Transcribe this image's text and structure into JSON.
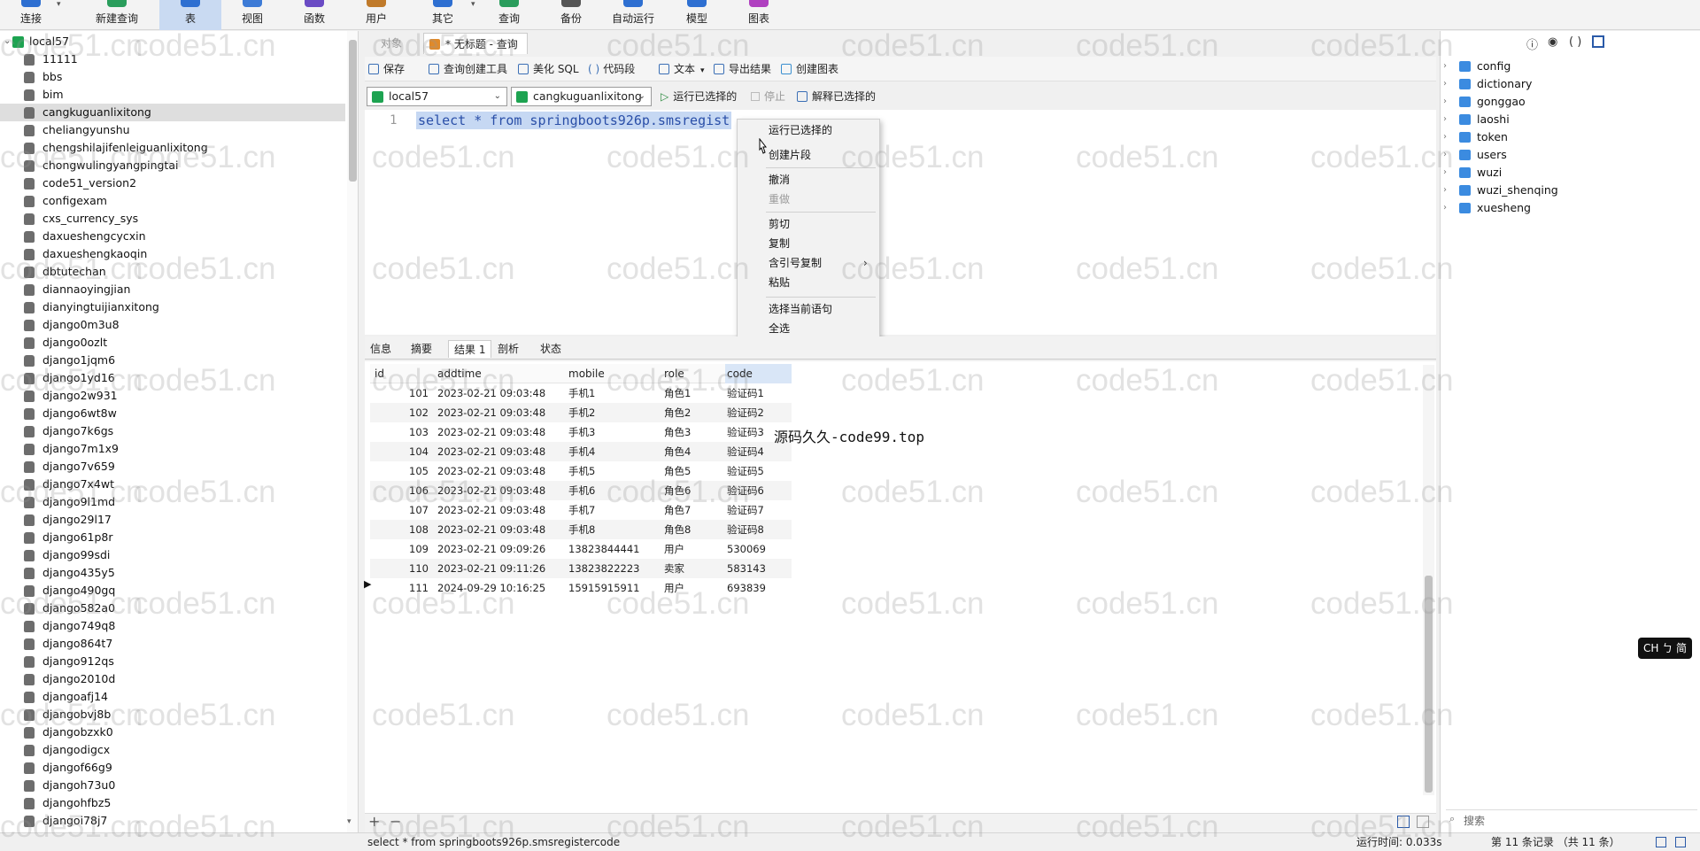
{
  "toolbar": {
    "buttons": [
      {
        "label": "连接",
        "color": "#2e6fd1"
      },
      {
        "label": "新建查询",
        "color": "#2a9d5c"
      },
      {
        "label": "表",
        "color": "#2e6fd1"
      },
      {
        "label": "视图",
        "color": "#3d7bd6"
      },
      {
        "label": "函数",
        "color": "#6a4bc4"
      },
      {
        "label": "用户",
        "color": "#c07a2a"
      },
      {
        "label": "其它",
        "color": "#2e6fd1"
      },
      {
        "label": "查询",
        "color": "#2a9d5c"
      },
      {
        "label": "备份",
        "color": "#555555"
      },
      {
        "label": "自动运行",
        "color": "#2e6fd1"
      },
      {
        "label": "模型",
        "color": "#2e6fd1"
      },
      {
        "label": "图表",
        "color": "#b040c0"
      }
    ]
  },
  "sidebar": {
    "connection": "local57",
    "items": [
      "11111",
      "bbs",
      "bim",
      "cangkuguanlixitong",
      "cheliangyunshu",
      "chengshilajifenleiguanlixitong",
      "chongwulingyangpingtai",
      "code51_version2",
      "configexam",
      "cxs_currency_sys",
      "daxueshengcycxin",
      "daxueshengkaoqin",
      "dbtutechan",
      "diannaoyingjian",
      "dianyingtuijianxitong",
      "django0m3u8",
      "django0ozlt",
      "django1jqm6",
      "django1yd16",
      "django2w931",
      "django6wt8w",
      "django7k6gs",
      "django7m1x9",
      "django7v659",
      "django7x4wt",
      "django9l1md",
      "django29l17",
      "django61p8r",
      "django99sdi",
      "django435y5",
      "django490gq",
      "django582a0",
      "django749q8",
      "django864t7",
      "django912qs",
      "django2010d",
      "djangoafj14",
      "djangobvj8b",
      "djangobzxk0",
      "djangodigcx",
      "djangof66g9",
      "djangoh73u0",
      "djangohfbz5",
      "djangoi78j7"
    ],
    "selected": "cangkuguanlixitong"
  },
  "tabs": {
    "objects": "对象",
    "query": "* 无标题 - 查询"
  },
  "editor_toolbar": {
    "save": "保存",
    "query_builder": "查询创建工具",
    "beautify": "美化 SQL",
    "snippet": "代码段",
    "text": "文本",
    "export": "导出结果",
    "create_chart": "创建图表"
  },
  "run_bar": {
    "connection": "local57",
    "database": "cangkuguanlixitong",
    "run_selected": "运行已选择的",
    "stop": "停止",
    "explain": "解释已选择的"
  },
  "editor": {
    "line_number": "1",
    "sql": "select  * from springboots926p.smsregist"
  },
  "context_menu": {
    "items": [
      {
        "label": "运行已选择的",
        "disabled": false
      },
      {
        "label": "创建片段",
        "disabled": false
      },
      {
        "label": "撤消",
        "disabled": false
      },
      {
        "label": "重做",
        "disabled": true
      },
      {
        "label": "剪切",
        "disabled": false
      },
      {
        "label": "复制",
        "disabled": false
      },
      {
        "label": "含引号复制",
        "disabled": false
      },
      {
        "label": "粘贴",
        "disabled": false
      },
      {
        "label": "选择当前语句",
        "disabled": false
      },
      {
        "label": "全选",
        "disabled": false
      }
    ],
    "submenu_arrow": "›"
  },
  "result_tabs": [
    "信息",
    "摘要",
    "结果 1",
    "剖析",
    "状态"
  ],
  "grid": {
    "columns": [
      "id",
      "addtime",
      "mobile",
      "role",
      "code"
    ],
    "rows": [
      [
        "101",
        "2023-02-21 09:03:48",
        "手机1",
        "角色1",
        "验证码1"
      ],
      [
        "102",
        "2023-02-21 09:03:48",
        "手机2",
        "角色2",
        "验证码2"
      ],
      [
        "103",
        "2023-02-21 09:03:48",
        "手机3",
        "角色3",
        "验证码3"
      ],
      [
        "104",
        "2023-02-21 09:03:48",
        "手机4",
        "角色4",
        "验证码4"
      ],
      [
        "105",
        "2023-02-21 09:03:48",
        "手机5",
        "角色5",
        "验证码5"
      ],
      [
        "106",
        "2023-02-21 09:03:48",
        "手机6",
        "角色6",
        "验证码6"
      ],
      [
        "107",
        "2023-02-21 09:03:48",
        "手机7",
        "角色7",
        "验证码7"
      ],
      [
        "108",
        "2023-02-21 09:03:48",
        "手机8",
        "角色8",
        "验证码8"
      ],
      [
        "109",
        "2023-02-21 09:09:26",
        "13823844441",
        "用户",
        "530069"
      ],
      [
        "110",
        "2023-02-21 09:11:26",
        "13823822223",
        "卖家",
        "583143"
      ],
      [
        "111",
        "2024-09-29 10:16:25",
        "15915915911",
        "用户",
        "693839"
      ]
    ]
  },
  "overlay_text": "源码久久-code99.top",
  "right_panel": {
    "tables": [
      "config",
      "dictionary",
      "gonggao",
      "laoshi",
      "token",
      "users",
      "wuzi",
      "wuzi_shenqing",
      "xuesheng"
    ],
    "search_placeholder": "搜索"
  },
  "ime_badge": "CH ㄅ 简",
  "statusbar": {
    "sql": "select  * from springboots926p.smsregistercode",
    "runtime": "运行时间: 0.033s",
    "records": "第 11 条记录 （共 11 条）"
  },
  "watermark": "code51.cn"
}
